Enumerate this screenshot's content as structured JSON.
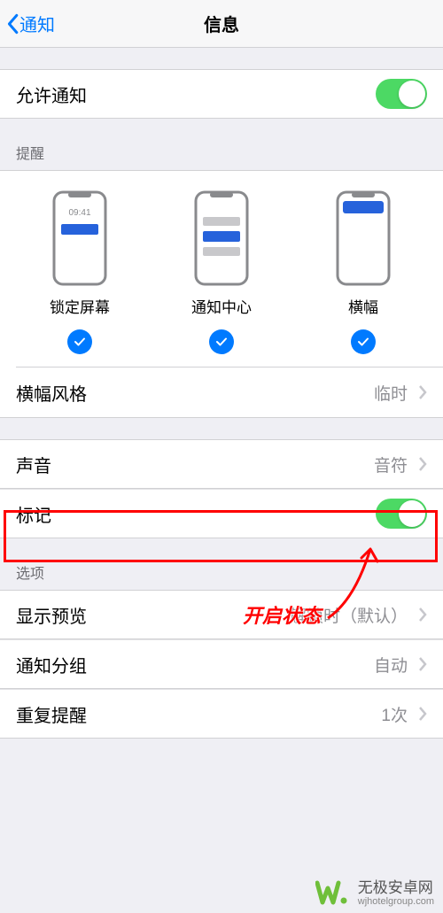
{
  "nav": {
    "back": "通知",
    "title": "信息"
  },
  "allow": {
    "label": "允许通知"
  },
  "alerts_header": "提醒",
  "alerts": {
    "lock": "锁定屏幕",
    "center": "通知中心",
    "banner": "横幅",
    "lock_time": "09:41"
  },
  "banner_style": {
    "label": "横幅风格",
    "value": "临时"
  },
  "sound": {
    "label": "声音",
    "value": "音符"
  },
  "badge": {
    "label": "标记"
  },
  "options_header": "选项",
  "preview": {
    "label": "显示预览",
    "value": "解锁时（默认）"
  },
  "grouping": {
    "label": "通知分组",
    "value": "自动"
  },
  "repeat": {
    "label": "重复提醒",
    "value": "1次"
  },
  "annotation": {
    "text": "开启状态"
  },
  "watermark": {
    "name": "无极安卓网",
    "url": "wjhotelgroup.com"
  }
}
